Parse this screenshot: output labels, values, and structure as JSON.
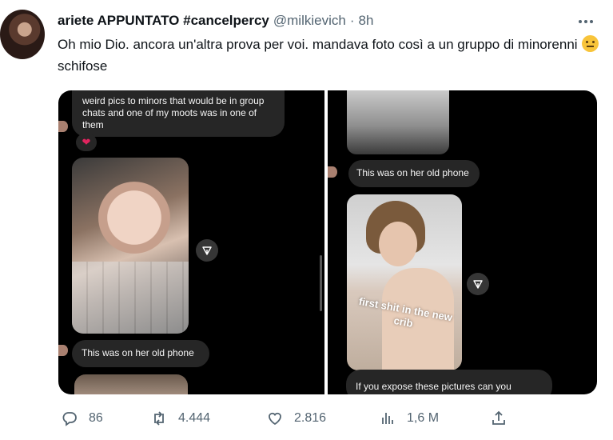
{
  "tweet": {
    "display_name": "ariete APPUNTATO #cancelpercy",
    "handle": "@milkievich",
    "separator": "·",
    "time": "8h",
    "text_before_emoji": "Oh mio Dio. ancora un'altra prova per voi. mandava foto così a un gruppo di minorenni",
    "emoji": "neutral-face-emoji",
    "text_after_emoji": "schifose"
  },
  "media": {
    "left_panel": {
      "top_bubble_text": "weird pics to minors that would be in group chats and one of my moots was in one of them",
      "reaction": "❤",
      "phone_bubble_text": "This was on her old phone"
    },
    "right_panel": {
      "phone_bubble_text": "This was on her old phone",
      "photo_caption": "first shit in the new crib",
      "expose_bubble_text": "If you expose these pictures can you"
    }
  },
  "actions": {
    "replies": "86",
    "retweets": "4.444",
    "likes": "2.816",
    "views": "1,6 M"
  },
  "colors": {
    "text_primary": "#0f1419",
    "text_secondary": "#536471",
    "dm_background": "#000000",
    "bubble": "#262626"
  }
}
